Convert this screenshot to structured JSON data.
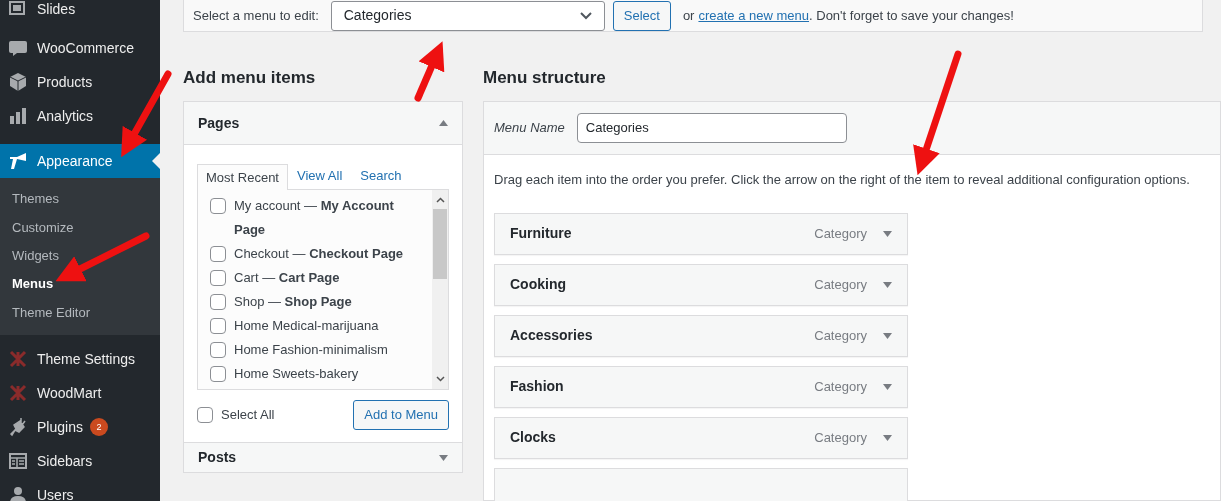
{
  "sidebar": {
    "items": [
      {
        "label": "Slides",
        "selected": false
      },
      {
        "label": "WooCommerce",
        "selected": false
      },
      {
        "label": "Products",
        "selected": false
      },
      {
        "label": "Analytics",
        "selected": false
      },
      {
        "label": "Appearance",
        "selected": true,
        "children": [
          {
            "label": "Themes",
            "selected": false
          },
          {
            "label": "Customize",
            "selected": false
          },
          {
            "label": "Widgets",
            "selected": false
          },
          {
            "label": "Menus",
            "selected": true
          },
          {
            "label": "Theme Editor",
            "selected": false
          }
        ]
      },
      {
        "label": "Theme Settings",
        "selected": false
      },
      {
        "label": "WoodMart",
        "selected": false
      },
      {
        "label": "Plugins",
        "selected": false,
        "badge": "2"
      },
      {
        "label": "Sidebars",
        "selected": false
      },
      {
        "label": "Users",
        "selected": false
      }
    ]
  },
  "menu_select": {
    "label": "Select a menu to edit:",
    "value": "Categories",
    "button": "Select",
    "note_before": "or",
    "link": "create a new menu",
    "note_after": ". Don't forget to save your changes!"
  },
  "add_items": {
    "heading": "Add menu items",
    "panel_title": "Pages",
    "tabs": [
      {
        "label": "Most Recent",
        "selected": true
      },
      {
        "label": "View All",
        "selected": false
      },
      {
        "label": "Search",
        "selected": false
      }
    ],
    "pages": [
      {
        "label": "My account — **My Account Page**",
        "checked": false
      },
      {
        "label": "Checkout — **Checkout Page**",
        "checked": false
      },
      {
        "label": "Cart — **Cart Page**",
        "checked": false
      },
      {
        "label": "Shop — **Shop Page**",
        "checked": false
      },
      {
        "label": "Home Medical-marijuana",
        "checked": false
      },
      {
        "label": "Home Fashion-minimalism",
        "checked": false
      },
      {
        "label": "Home Sweets-bakery",
        "checked": false
      }
    ],
    "select_all": {
      "label": "Select All",
      "checked": false
    },
    "button": "Add to Menu",
    "next_panel_title": "Posts"
  },
  "menu_structure": {
    "heading": "Menu structure",
    "name_label": "Menu Name",
    "name_value": "Categories",
    "instructions": "Drag each item into the order you prefer. Click the arrow on the right of the item to reveal additional configuration options.",
    "items": [
      {
        "title": "Furniture",
        "type": "Category"
      },
      {
        "title": "Cooking",
        "type": "Category"
      },
      {
        "title": "Accessories",
        "type": "Category"
      },
      {
        "title": "Fashion",
        "type": "Category"
      },
      {
        "title": "Clocks",
        "type": "Category"
      }
    ]
  }
}
